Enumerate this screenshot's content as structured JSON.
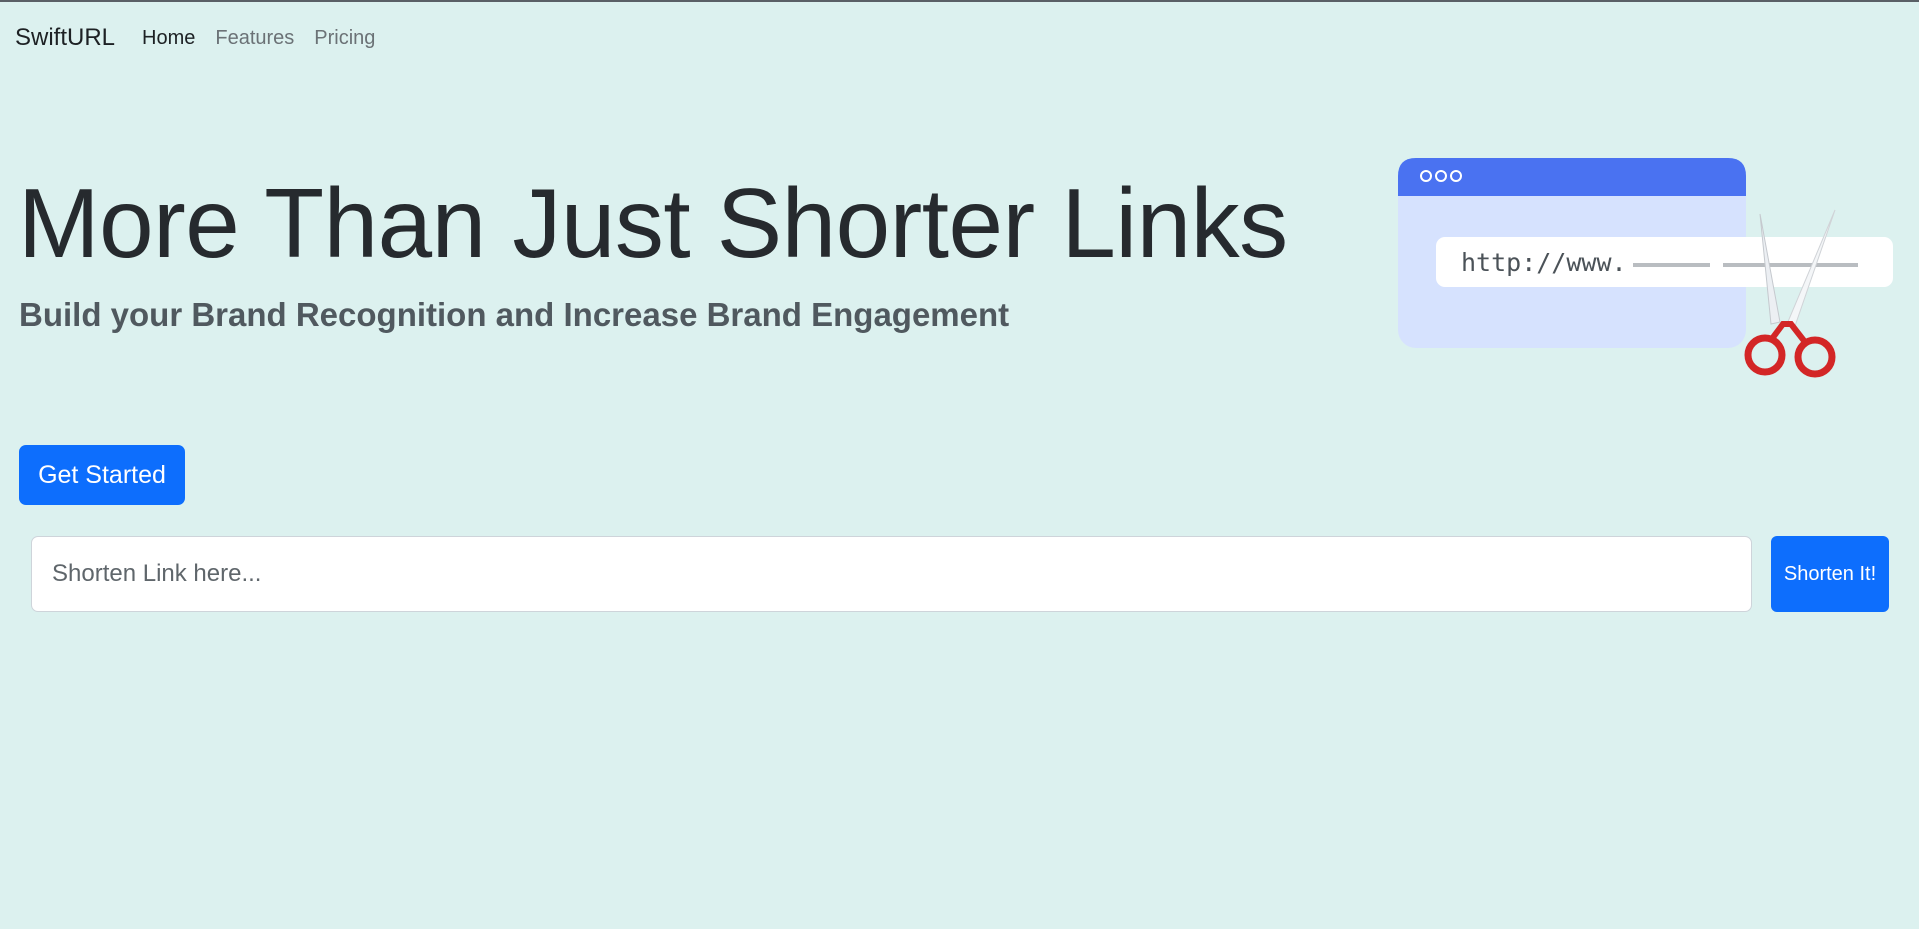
{
  "navbar": {
    "brand": "SwiftURL",
    "links": [
      {
        "label": "Home",
        "active": true
      },
      {
        "label": "Features",
        "active": false
      },
      {
        "label": "Pricing",
        "active": false
      }
    ]
  },
  "hero": {
    "title": "More Than Just Shorter Links",
    "subtitle": "Build your Brand Recognition and Increase Brand Engagement",
    "cta_label": "Get Started"
  },
  "illustration": {
    "url_text": "http://www."
  },
  "shortener": {
    "placeholder": "Shorten Link here...",
    "value": "",
    "button_label": "Shorten It!"
  },
  "colors": {
    "background": "#dcf1ef",
    "primary": "#0d6efd",
    "scissors": "#d32626"
  }
}
